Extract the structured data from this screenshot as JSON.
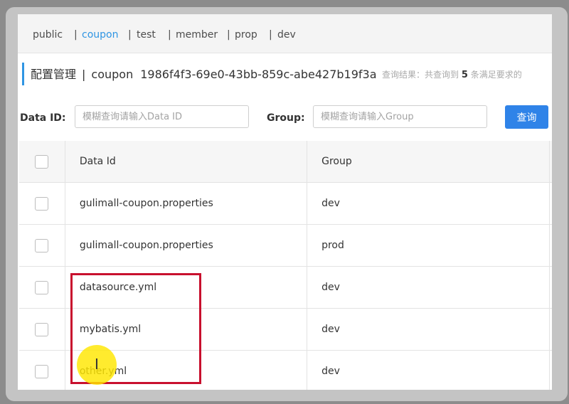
{
  "namespaces": [
    {
      "label": "public",
      "active": false
    },
    {
      "label": "coupon",
      "active": true
    },
    {
      "label": "test",
      "active": false
    },
    {
      "label": "member",
      "active": false
    },
    {
      "label": "prop",
      "active": false
    },
    {
      "label": "dev",
      "active": false
    }
  ],
  "ns_separator": "|",
  "header": {
    "title": "配置管理",
    "separator": "|",
    "namespace_name": "coupon",
    "namespace_id": "1986f4f3-69e0-43bb-859c-abe427b19f3a",
    "query_summary_prefix": "查询结果：共查询到",
    "query_count": "5",
    "query_summary_suffix": "条满足要求的"
  },
  "search": {
    "data_id_label": "Data ID:",
    "data_id_placeholder": "模糊查询请输入Data ID",
    "group_label": "Group:",
    "group_placeholder": "模糊查询请输入Group",
    "button_label": "查询"
  },
  "table": {
    "columns": [
      "Data Id",
      "Group"
    ],
    "rows": [
      {
        "data_id": "gulimall-coupon.properties",
        "group": "dev"
      },
      {
        "data_id": "gulimall-coupon.properties",
        "group": "prod"
      },
      {
        "data_id": "datasource.yml",
        "group": "dev"
      },
      {
        "data_id": "mybatis.yml",
        "group": "dev"
      },
      {
        "data_id": "other.yml",
        "group": "dev"
      }
    ]
  },
  "colors": {
    "accent": "#2f95e3",
    "button": "#2f83e8",
    "highlight_box": "#c8102e",
    "cursor_spot": "#ffe600"
  },
  "icons": {
    "cursor": "text-cursor-icon"
  }
}
